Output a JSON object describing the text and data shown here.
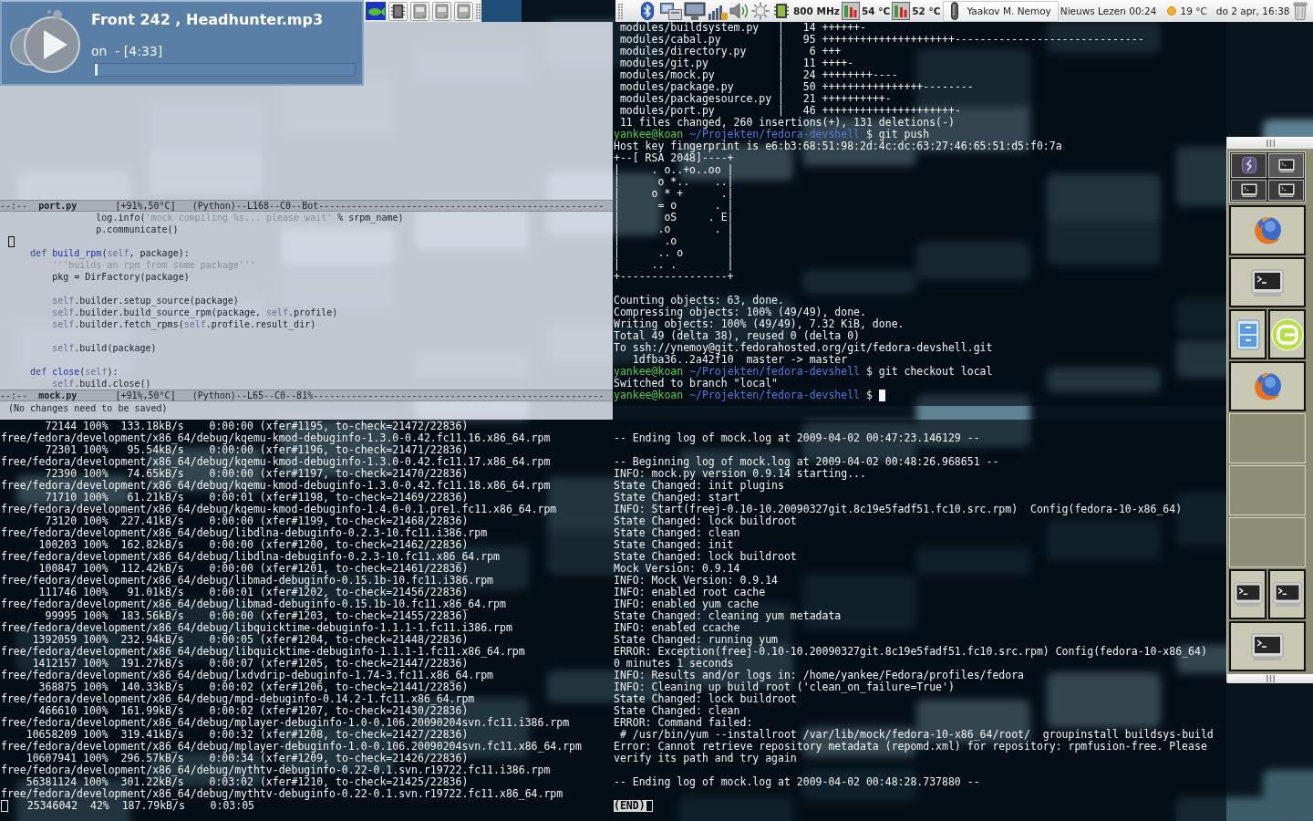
{
  "media_popup": {
    "title": "Front 242 , Headhunter.mp3",
    "subtitle": "on  - [4:33]",
    "progress": {
      "level": 0.01
    }
  },
  "top_panel": {
    "cpu_frequency": "800 MHz",
    "temperatures": [
      "54 °C",
      "52 °C"
    ],
    "user_name": "Yaakov M. Nemoy",
    "feed_reader": "Nieuws Lezen 00:24",
    "weather": "19 °C",
    "clock": "do 2 apr, 16:38"
  },
  "editor": {
    "upper_mode_line": {
      "status": "--:--",
      "buffer": "port.py",
      "position": "[+91%,50°C]",
      "mode": "(Python)--L168--C0--Bot----------------------------------------------------"
    },
    "code_lines": [
      {
        "kind": "code",
        "tokens": [
          {
            "kind": "plain",
            "text": "                log.info("
          },
          {
            "kind": "string",
            "text": "'mock compiling %s... please wait'"
          },
          {
            "kind": "plain",
            "text": " % srpm_name)"
          }
        ]
      },
      {
        "kind": "code",
        "tokens": [
          {
            "kind": "plain",
            "text": "                p.communicate()"
          }
        ]
      },
      {
        "kind": "cursor"
      },
      {
        "kind": "code",
        "tokens": [
          {
            "kind": "keyword",
            "text": "    def "
          },
          {
            "kind": "function",
            "text": "build_rpm"
          },
          {
            "kind": "plain",
            "text": "("
          },
          {
            "kind": "self",
            "text": "self"
          },
          {
            "kind": "plain",
            "text": ", package):"
          }
        ]
      },
      {
        "kind": "code",
        "tokens": [
          {
            "kind": "string",
            "text": "        '''builds an rpm from some package'''"
          }
        ]
      },
      {
        "kind": "code",
        "tokens": [
          {
            "kind": "plain",
            "text": "        pkg = DirFactory(package)"
          }
        ]
      },
      {
        "kind": "blank"
      },
      {
        "kind": "code",
        "tokens": [
          {
            "kind": "self",
            "text": "        self"
          },
          {
            "kind": "plain",
            "text": ".builder.setup_source(package)"
          }
        ]
      },
      {
        "kind": "code",
        "tokens": [
          {
            "kind": "self",
            "text": "        self"
          },
          {
            "kind": "plain",
            "text": ".builder.build_source_rpm(package, "
          },
          {
            "kind": "self",
            "text": "self"
          },
          {
            "kind": "plain",
            "text": ".profile)"
          }
        ]
      },
      {
        "kind": "code",
        "tokens": [
          {
            "kind": "self",
            "text": "        self"
          },
          {
            "kind": "plain",
            "text": ".builder.fetch_rpms("
          },
          {
            "kind": "self",
            "text": "self"
          },
          {
            "kind": "plain",
            "text": ".profile.result_dir)"
          }
        ]
      },
      {
        "kind": "blank"
      },
      {
        "kind": "code",
        "tokens": [
          {
            "kind": "self",
            "text": "        self"
          },
          {
            "kind": "plain",
            "text": ".build(package)"
          }
        ]
      },
      {
        "kind": "blank"
      },
      {
        "kind": "code",
        "tokens": [
          {
            "kind": "keyword",
            "text": "    def "
          },
          {
            "kind": "function",
            "text": "close"
          },
          {
            "kind": "plain",
            "text": "("
          },
          {
            "kind": "self",
            "text": "self"
          },
          {
            "kind": "plain",
            "text": "):"
          }
        ]
      },
      {
        "kind": "code",
        "tokens": [
          {
            "kind": "self",
            "text": "        self"
          },
          {
            "kind": "plain",
            "text": ".build.close()"
          }
        ]
      }
    ],
    "lower_mode_line": {
      "status": "--:--",
      "buffer": "mock.py",
      "position": "[+91%,50°C]",
      "mode": "(Python)--L65--C0--81%-----------------------------------------------------"
    },
    "echo_area": "(No changes need to be saved)"
  },
  "rsync_terminal": {
    "lines": [
      {
        "kind": "output",
        "text": "       72144 100%  133.18kB/s    0:00:00 (xfer#1195, to-check=21472/22836)"
      },
      {
        "kind": "output",
        "text": "free/fedora/development/x86_64/debug/kqemu-kmod-debuginfo-1.3.0-0.42.fc11.16.x86_64.rpm"
      },
      {
        "kind": "output",
        "text": "       72301 100%   95.54kB/s    0:00:00 (xfer#1196, to-check=21471/22836)"
      },
      {
        "kind": "output",
        "text": "free/fedora/development/x86_64/debug/kqemu-kmod-debuginfo-1.3.0-0.42.fc11.17.x86_64.rpm"
      },
      {
        "kind": "output",
        "text": "       72390 100%   74.65kB/s    0:00:00 (xfer#1197, to-check=21470/22836)"
      },
      {
        "kind": "output",
        "text": "free/fedora/development/x86_64/debug/kqemu-kmod-debuginfo-1.3.0-0.42.fc11.18.x86_64.rpm"
      },
      {
        "kind": "output",
        "text": "       71710 100%   61.21kB/s    0:00:01 (xfer#1198, to-check=21469/22836)"
      },
      {
        "kind": "output",
        "text": "free/fedora/development/x86_64/debug/kqemu-kmod-debuginfo-1.4.0-0.1.pre1.fc11.x86_64.rpm"
      },
      {
        "kind": "output",
        "text": "       73120 100%  227.41kB/s    0:00:00 (xfer#1199, to-check=21468/22836)"
      },
      {
        "kind": "output",
        "text": "free/fedora/development/x86_64/debug/libdlna-debuginfo-0.2.3-10.fc11.i386.rpm"
      },
      {
        "kind": "output",
        "text": "      100203 100%  162.82kB/s    0:00:00 (xfer#1200, to-check=21462/22836)"
      },
      {
        "kind": "output",
        "text": "free/fedora/development/x86_64/debug/libdlna-debuginfo-0.2.3-10.fc11.x86_64.rpm"
      },
      {
        "kind": "output",
        "text": "      100847 100%  112.42kB/s    0:00:00 (xfer#1201, to-check=21461/22836)"
      },
      {
        "kind": "output",
        "text": "free/fedora/development/x86_64/debug/libmad-debuginfo-0.15.1b-10.fc11.i386.rpm"
      },
      {
        "kind": "output",
        "text": "      111746 100%   91.01kB/s    0:00:01 (xfer#1202, to-check=21456/22836)"
      },
      {
        "kind": "output",
        "text": "free/fedora/development/x86_64/debug/libmad-debuginfo-0.15.1b-10.fc11.x86_64.rpm"
      },
      {
        "kind": "output",
        "text": "       99995 100%  183.56kB/s    0:00:00 (xfer#1203, to-check=21455/22836)"
      },
      {
        "kind": "output",
        "text": "free/fedora/development/x86_64/debug/libquicktime-debuginfo-1.1.1-1.fc11.i386.rpm"
      },
      {
        "kind": "output",
        "text": "     1392059 100%  232.94kB/s    0:00:05 (xfer#1204, to-check=21448/22836)"
      },
      {
        "kind": "output",
        "text": "free/fedora/development/x86_64/debug/libquicktime-debuginfo-1.1.1-1.fc11.x86_64.rpm"
      },
      {
        "kind": "output",
        "text": "     1412157 100%  191.27kB/s    0:00:07 (xfer#1205, to-check=21447/22836)"
      },
      {
        "kind": "output",
        "text": "free/fedora/development/x86_64/debug/lxdvdrip-debuginfo-1.74-3.fc11.x86_64.rpm"
      },
      {
        "kind": "output",
        "text": "      368875 100%  140.33kB/s    0:00:02 (xfer#1206, to-check=21441/22836)"
      },
      {
        "kind": "output",
        "text": "free/fedora/development/x86_64/debug/mpd-debuginfo-0.14.2-1.fc11.x86_64.rpm"
      },
      {
        "kind": "output",
        "text": "      466610 100%  161.99kB/s    0:00:02 (xfer#1207, to-check=21430/22836)"
      },
      {
        "kind": "output",
        "text": "free/fedora/development/x86_64/debug/mplayer-debuginfo-1.0-0.106.20090204svn.fc11.i386.rpm"
      },
      {
        "kind": "output",
        "text": "    10658209 100%  319.41kB/s    0:00:32 (xfer#1208, to-check=21427/22836)"
      },
      {
        "kind": "output",
        "text": "free/fedora/development/x86_64/debug/mplayer-debuginfo-1.0-0.106.20090204svn.fc11.x86_64.rpm"
      },
      {
        "kind": "output",
        "text": "    10607941 100%  296.57kB/s    0:00:34 (xfer#1209, to-check=21426/22836)"
      },
      {
        "kind": "output",
        "text": "free/fedora/development/x86_64/debug/mythtv-debuginfo-0.22-0.1.svn.r19722.fc11.i386.rpm"
      },
      {
        "kind": "output",
        "text": "    56381124 100%  301.22kB/s    0:03:02 (xfer#1210, to-check=21425/22836)"
      },
      {
        "kind": "output",
        "text": "free/fedora/development/x86_64/debug/mythtv-debuginfo-0.22-0.1.svn.r19722.fc11.x86_64.rpm"
      },
      {
        "kind": "progress",
        "text": "   25346042  42%  187.79kB/s    0:03:05"
      }
    ]
  },
  "git_terminal": {
    "lines": [
      {
        "kind": "output",
        "text": " modules/buildsystem.py   |   14 ++++++-"
      },
      {
        "kind": "output",
        "text": " modules/cabal.py         |   95 +++++++++++++++++++++------------------------------"
      },
      {
        "kind": "output",
        "text": " modules/directory.py     |    6 +++"
      },
      {
        "kind": "output",
        "text": " modules/git.py           |   11 ++++-"
      },
      {
        "kind": "output",
        "text": " modules/mock.py          |   24 ++++++++----"
      },
      {
        "kind": "output",
        "text": " modules/package.py       |   50 ++++++++++++++++--------"
      },
      {
        "kind": "output",
        "text": " modules/packagesource.py |   21 ++++++++++-"
      },
      {
        "kind": "output",
        "text": " modules/port.py          |   46 +++++++++++++++++++++-"
      },
      {
        "kind": "output",
        "text": " 11 files changed, 260 insertions(+), 131 deletions(-)"
      },
      {
        "kind": "prompt",
        "user": "yankee@koan",
        "path": "~/Projekten/fedora-devshell",
        "symbol": "$",
        "command": "git push"
      },
      {
        "kind": "output",
        "text": "Host key fingerprint is e6:b3:68:51:98:2d:4c:dc:63:27:46:65:51:d5:f0:7a"
      },
      {
        "kind": "output",
        "text": "+--[ RSA 2048]----+"
      },
      {
        "kind": "output",
        "text": "|     . o..+o..oo |"
      },
      {
        "kind": "output",
        "text": "|      o *..    ..|"
      },
      {
        "kind": "output",
        "text": "|     o * +      .|"
      },
      {
        "kind": "output",
        "text": "|      = o      . |"
      },
      {
        "kind": "output",
        "text": "|       oS     . E|"
      },
      {
        "kind": "output",
        "text": "|      .o       . |"
      },
      {
        "kind": "output",
        "text": "|       .o        |"
      },
      {
        "kind": "output",
        "text": "|      .. o       |"
      },
      {
        "kind": "output",
        "text": "|     .. .        |"
      },
      {
        "kind": "output",
        "text": "+-----------------+"
      },
      {
        "kind": "blank"
      },
      {
        "kind": "output",
        "text": "Counting objects: 63, done."
      },
      {
        "kind": "output",
        "text": "Compressing objects: 100% (49/49), done."
      },
      {
        "kind": "output",
        "text": "Writing objects: 100% (49/49), 7.32 KiB, done."
      },
      {
        "kind": "output",
        "text": "Total 49 (delta 38), reused 0 (delta 0)"
      },
      {
        "kind": "output",
        "text": "To ssh://ynemoy@git.fedorahosted.org/git/fedora-devshell.git"
      },
      {
        "kind": "output",
        "text": "   1dfba36..2a42f10  master -> master"
      },
      {
        "kind": "prompt",
        "user": "yankee@koan",
        "path": "~/Projekten/fedora-devshell",
        "symbol": "$",
        "command": "git checkout local"
      },
      {
        "kind": "output",
        "text": "Switched to branch \"local\""
      },
      {
        "kind": "input",
        "user": "yankee@koan",
        "path": "~/Projekten/fedora-devshell",
        "symbol": "$"
      }
    ]
  },
  "mock_log": {
    "lines": [
      {
        "kind": "blank"
      },
      {
        "kind": "output",
        "text": "-- Ending log of mock.log at 2009-04-02 00:47:23.146129 --"
      },
      {
        "kind": "blank"
      },
      {
        "kind": "output",
        "text": "-- Beginning log of mock.log at 2009-04-02 00:48:26.968651 --"
      },
      {
        "kind": "output",
        "text": "INFO: mock.py version 0.9.14 starting..."
      },
      {
        "kind": "output",
        "text": "State Changed: init plugins"
      },
      {
        "kind": "output",
        "text": "State Changed: start"
      },
      {
        "kind": "output",
        "text": "INFO: Start(freej-0.10-10.20090327git.8c19e5fadf51.fc10.src.rpm)  Config(fedora-10-x86_64)"
      },
      {
        "kind": "output",
        "text": "State Changed: lock buildroot"
      },
      {
        "kind": "output",
        "text": "State Changed: clean"
      },
      {
        "kind": "output",
        "text": "State Changed: init"
      },
      {
        "kind": "output",
        "text": "State Changed: lock buildroot"
      },
      {
        "kind": "output",
        "text": "Mock Version: 0.9.14"
      },
      {
        "kind": "output",
        "text": "INFO: Mock Version: 0.9.14"
      },
      {
        "kind": "output",
        "text": "INFO: enabled root cache"
      },
      {
        "kind": "output",
        "text": "INFO: enabled yum cache"
      },
      {
        "kind": "output",
        "text": "State Changed: cleaning yum metadata"
      },
      {
        "kind": "output",
        "text": "INFO: enabled ccache"
      },
      {
        "kind": "output",
        "text": "State Changed: running yum"
      },
      {
        "kind": "output",
        "text": "ERROR: Exception(freej-0.10-10.20090327git.8c19e5fadf51.fc10.src.rpm) Config(fedora-10-x86_64)"
      },
      {
        "kind": "output",
        "text": "0 minutes 1 seconds"
      },
      {
        "kind": "output",
        "text": "INFO: Results and/or logs in: /home/yankee/Fedora/profiles/fedora"
      },
      {
        "kind": "output",
        "text": "INFO: Cleaning up build root ('clean_on_failure=True')"
      },
      {
        "kind": "output",
        "text": "State Changed: lock buildroot"
      },
      {
        "kind": "output",
        "text": "State Changed: clean"
      },
      {
        "kind": "output",
        "text": "ERROR: Command failed:"
      },
      {
        "kind": "output",
        "text": " # /usr/bin/yum --installroot /var/lib/mock/fedora-10-x86_64/root/  groupinstall buildsys-build"
      },
      {
        "kind": "output",
        "text": "Error: Cannot retrieve repository metadata (repomd.xml) for repository: rpmfusion-free. Please"
      },
      {
        "kind": "output",
        "text": "verify its path and try again"
      },
      {
        "kind": "blank"
      },
      {
        "kind": "output",
        "text": "-- Ending log of mock.log at 2009-04-02 00:48:28.737880 --"
      },
      {
        "kind": "blank"
      },
      {
        "kind": "pager",
        "text": "(END)"
      }
    ]
  }
}
